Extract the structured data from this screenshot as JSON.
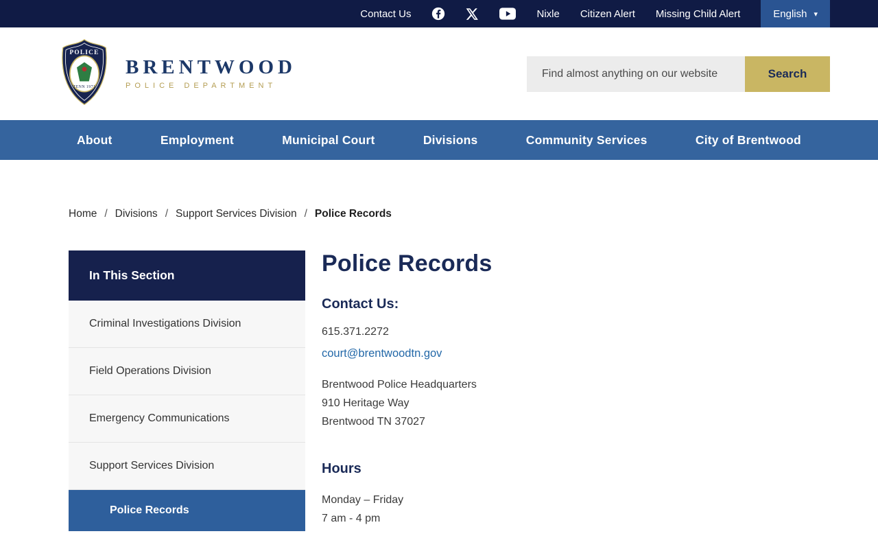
{
  "topbar": {
    "contact_us": "Contact Us",
    "links": [
      "Nixle",
      "Citizen Alert",
      "Missing Child Alert"
    ],
    "language": "English",
    "caret": "▾"
  },
  "header": {
    "brand_name": "BRENTWOOD",
    "brand_sub": "POLICE DEPARTMENT",
    "logo_text_top": "POLICE",
    "logo_text_bottom": "TENN 1971",
    "search_placeholder": "Find almost anything on our website",
    "search_button": "Search"
  },
  "nav": {
    "items": [
      "About",
      "Employment",
      "Municipal Court",
      "Divisions",
      "Community Services",
      "City of Brentwood"
    ]
  },
  "breadcrumb": {
    "separator": "/",
    "items": [
      "Home",
      "Divisions",
      "Support Services Division"
    ],
    "current": "Police Records"
  },
  "sidebar": {
    "title": "In This Section",
    "items": [
      "Criminal Investigations Division",
      "Field Operations Division",
      "Emergency Communications",
      "Support Services Division"
    ],
    "active": "Police Records"
  },
  "main": {
    "title": "Police Records",
    "contact_heading": "Contact Us:",
    "phone": "615.371.2272",
    "email": "court@brentwoodtn.gov",
    "address_line1": "Brentwood Police Headquarters",
    "address_line2": "910 Heritage Way",
    "address_line3": "Brentwood TN 37027",
    "hours_heading": "Hours",
    "hours_line1": "Monday – Friday",
    "hours_line2": "7 am - 4 pm"
  },
  "colors": {
    "topbar_navy": "#101b45",
    "nav_blue": "#35649e",
    "active_blue": "#2e5f9c",
    "gold": "#c9b663",
    "heading_navy": "#1a2a57",
    "link_blue": "#2368a8"
  }
}
